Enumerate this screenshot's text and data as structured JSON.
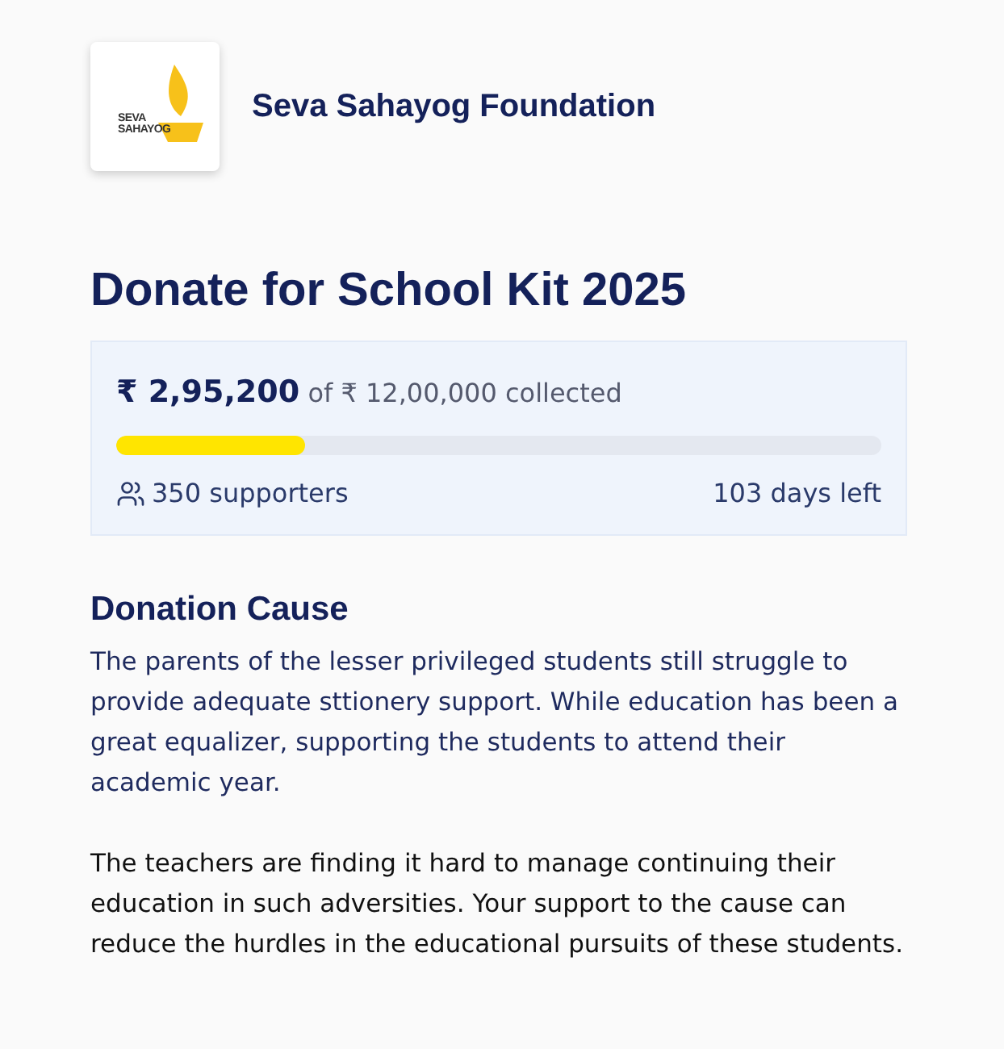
{
  "organization": {
    "logo_lines": [
      "SEVA",
      "SAHAYOG"
    ],
    "name": "Seva Sahayog Foundation"
  },
  "campaign": {
    "title": "Donate for School Kit 2025",
    "raised": "₹ 2,95,200",
    "goal_text": "of ₹ 12,00,000 collected",
    "level": 0.246,
    "supporters": "350 supporters",
    "days_left": "103 days left"
  },
  "cause": {
    "heading": "Donation Cause",
    "paragraphs": [
      {
        "kind": "accent",
        "text": "The parents of the lesser privileged students still struggle to provide adequate sttionery support. While education has been a great equalizer, supporting the students to attend their academic year."
      },
      {
        "kind": "plain",
        "text": "The teachers are finding it hard to manage continuing their education in such adversities. Your support to the cause can reduce the hurdles in the educational pursuits of these students."
      }
    ]
  }
}
